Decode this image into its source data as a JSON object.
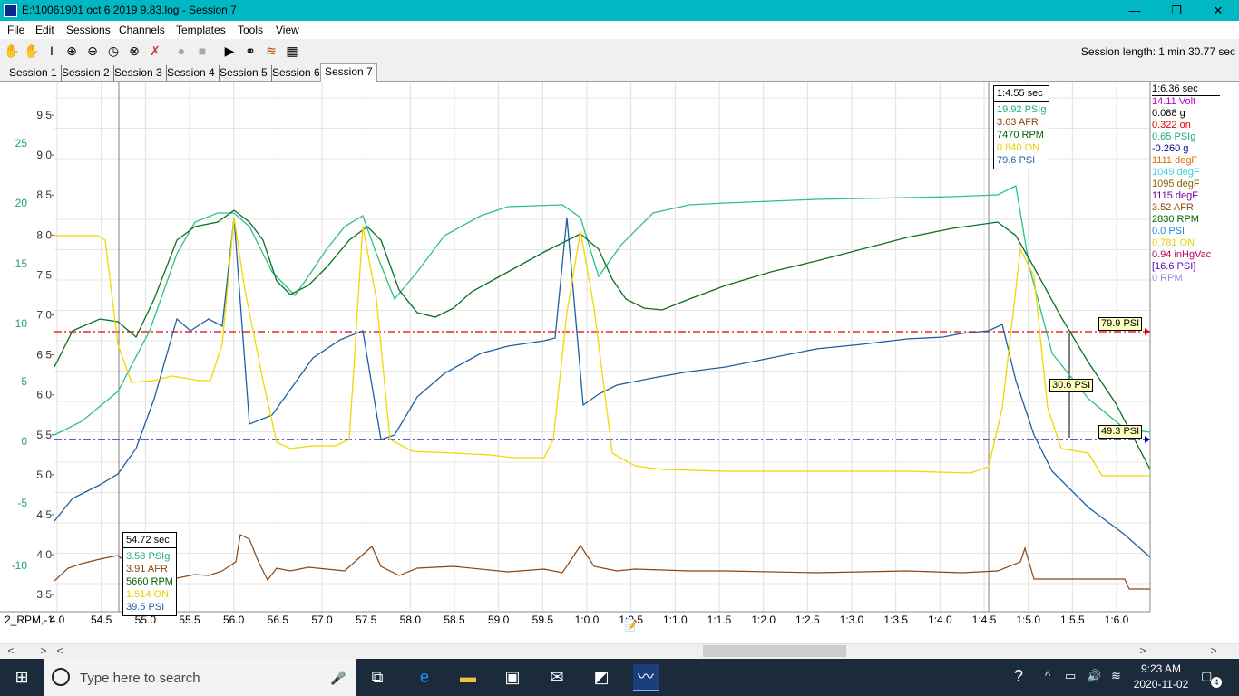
{
  "window": {
    "title": "E:\\10061901 oct 6 2019 9.83.log - Session 7",
    "minimize": "—",
    "maximize": "❐",
    "close": "✕"
  },
  "menu": [
    "File",
    "Edit",
    "Sessions",
    "Channels",
    "Templates",
    "Tools",
    "View"
  ],
  "toolbar": {
    "session_length": "Session length:  1 min 30.77 sec"
  },
  "tabs": [
    "Session 1",
    "Session 2",
    "Session 3",
    "Session 4",
    "Session 5",
    "Session 6",
    "Session 7"
  ],
  "active_tab": 6,
  "chart": {
    "x_axis_label": "2_RPM,-1",
    "x_ticks": [
      "4.0",
      "54.5",
      "55.0",
      "55.5",
      "56.0",
      "56.5",
      "57.0",
      "57.5",
      "58.0",
      "58.5",
      "59.0",
      "59.5",
      "1:0.0",
      "1:0.5",
      "1:1.0",
      "1:1.5",
      "1:2.0",
      "1:2.5",
      "1:3.0",
      "1:3.5",
      "1:4.0",
      "1:4.5",
      "1:5.0",
      "1:5.5",
      "1:6.0"
    ],
    "y_left_teal": [
      "25",
      "20",
      "15",
      "10",
      "5",
      "0",
      "-5",
      "-10"
    ],
    "y_left_dark": [
      "9.5",
      "9.0",
      "8.5",
      "8.0",
      "7.5",
      "7.0",
      "6.5",
      "6.0",
      "5.5",
      "5.0",
      "4.5",
      "4.0",
      "3.5"
    ],
    "cursor1": {
      "title": "54.72 sec",
      "values": [
        {
          "text": "3.58 PSIg",
          "color": "#20b070"
        },
        {
          "text": "3.91 AFR",
          "color": "#8b4513"
        },
        {
          "text": "5660 RPM",
          "color": "#006400"
        },
        {
          "text": "1.514 ON",
          "color": "#e8d000"
        },
        {
          "text": "39.5 PSI",
          "color": "#1f5fa0"
        }
      ]
    },
    "cursor2": {
      "title": "1:4.55 sec",
      "values": [
        {
          "text": "19.92 PSIg",
          "color": "#20b070"
        },
        {
          "text": "3.63 AFR",
          "color": "#8b4513"
        },
        {
          "text": "7470 RPM",
          "color": "#006400"
        },
        {
          "text": "0.840 ON",
          "color": "#e8d000"
        },
        {
          "text": "79.6 PSI",
          "color": "#1f5fa0"
        }
      ]
    },
    "markers": {
      "upper": "79.9 PSI",
      "lower": "49.3 PSI",
      "delta": "30.6 PSI"
    },
    "legend": {
      "time": "1:6.36 sec",
      "items": [
        {
          "text": "14.11 Volt",
          "color": "#c000c0"
        },
        {
          "text": "0.088 g",
          "color": "#000000"
        },
        {
          "text": "0.322 on",
          "color": "#e00000"
        },
        {
          "text": "0.65 PSIg",
          "color": "#20b070"
        },
        {
          "text": "-0.260 g",
          "color": "#00008b"
        },
        {
          "text": "1111 degF",
          "color": "#e07000"
        },
        {
          "text": "1049 degF",
          "color": "#40d0e0"
        },
        {
          "text": "1095 degF",
          "color": "#8b6000"
        },
        {
          "text": "1115 degF",
          "color": "#7000a0"
        },
        {
          "text": "3.52 AFR",
          "color": "#8b4513"
        },
        {
          "text": "2830 RPM",
          "color": "#006400"
        },
        {
          "text": "0.0 PSI",
          "color": "#1f8fd0"
        },
        {
          "text": "0.781 ON",
          "color": "#e8d000"
        },
        {
          "text": "0.94 inHgVac",
          "color": "#c00060"
        },
        {
          "text": "[16.6 PSI]",
          "color": "#6000c0"
        },
        {
          "text": "0 RPM",
          "color": "#9090e0"
        }
      ]
    }
  },
  "taskbar": {
    "search_placeholder": "Type here to search",
    "time": "9:23 AM",
    "date": "2020-11-02",
    "notification_count": "4"
  }
}
